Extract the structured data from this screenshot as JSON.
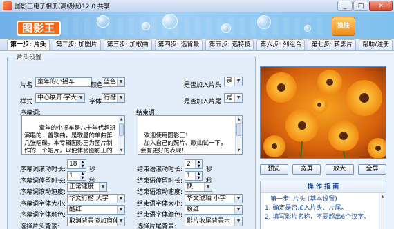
{
  "window": {
    "title": "图影王电子相册(高级版)12.0 共享",
    "minimize": "_",
    "restore": "□",
    "close": "✕"
  },
  "banner": {
    "logo_text": "图影王",
    "corner_text": "换肤"
  },
  "steps": [
    {
      "label": "第一步: 片头"
    },
    {
      "label": "第二步: 加图片"
    },
    {
      "label": "第三步: 加歌曲"
    },
    {
      "label": "第四步: 选背景"
    },
    {
      "label": "第五步: 选特技"
    },
    {
      "label": "第六步: 列组合"
    },
    {
      "label": "第七步: 转影片"
    },
    {
      "label": "帮助/注册"
    }
  ],
  "section": {
    "legend": "片头设置"
  },
  "form": {
    "title_label": "片名",
    "title_value": "童年的小摇车",
    "color_label": "颜色",
    "color_value": "蓝色",
    "add_head_label": "是否加入片头",
    "add_head_value": "是",
    "style_label": "样式",
    "style_value": "中心展开·字大",
    "font_label": "字体",
    "font_value": "行楷",
    "add_tail_label": "是否加入片尾",
    "add_tail_value": "是",
    "prologue_label": "序幕词:",
    "prologue_text": "    童年的小摇车是八十年代超班演唱的一首歌曲，是歌星的单曲第几张唱碟。本专辑图影王为图片制作的一个短片，以便体验图影王的制作效果。您可以自己制作一个更好的电影，卡拉OK片，MTV片等，想的数码...",
    "ending_label": "结束语:",
    "ending_text": "\n  欢迎使用图影王！\n  加入自己的照片、歌曲试一下，\n会有更好的表现！",
    "prologue_scroll_label": "序幕词滚动时长:",
    "prologue_scroll_value": "18",
    "prologue_stay_label": "序幕词停留时长:",
    "prologue_stay_value": "1",
    "ending_scroll_label": "结束语滚动时长:",
    "ending_scroll_value": "2",
    "ending_stay_label": "结束语停留时长:",
    "ending_stay_value": "1",
    "seconds": "秒",
    "prologue_speed_label": "序幕词滚动速度:",
    "prologue_speed_value": "正常速度",
    "ending_speed_label": "结束语滚动速度:",
    "ending_speed_value": "快",
    "prologue_fontsize_label": "序幕词字体大小:",
    "prologue_fontsize_value": "华文行楷 大字",
    "ending_fontsize_label": "结束语字体大小:",
    "ending_fontsize_value": "华文琥珀 小字",
    "prologue_color_label": "序幕词字体颜色:",
    "prologue_color_value": "酷红",
    "ending_color_label": "结束语字体颜色:",
    "ending_color_value": "粉红",
    "head_bg_label": "选择片头背景:",
    "head_bg_value": "取消背景添加窗体",
    "tail_bg_label": "选择片尾背景:",
    "tail_bg_value": "影片收尾背景六"
  },
  "preview_buttons": {
    "preview": "预览",
    "wide": "宽屏",
    "zoom": "放大",
    "fullscreen": "全屏"
  },
  "guide": {
    "title": "操 作 指 南",
    "step_head": "第一步: 片头  (基本设置)",
    "item1": "1. 确定是否加入片头、片尾。",
    "item2": "2. 填写影片名称，不要超出6个汉字。"
  },
  "colors": {
    "accent": "#1d4f99",
    "banner": "#7ec0ee",
    "logo": "#f06a1a"
  }
}
